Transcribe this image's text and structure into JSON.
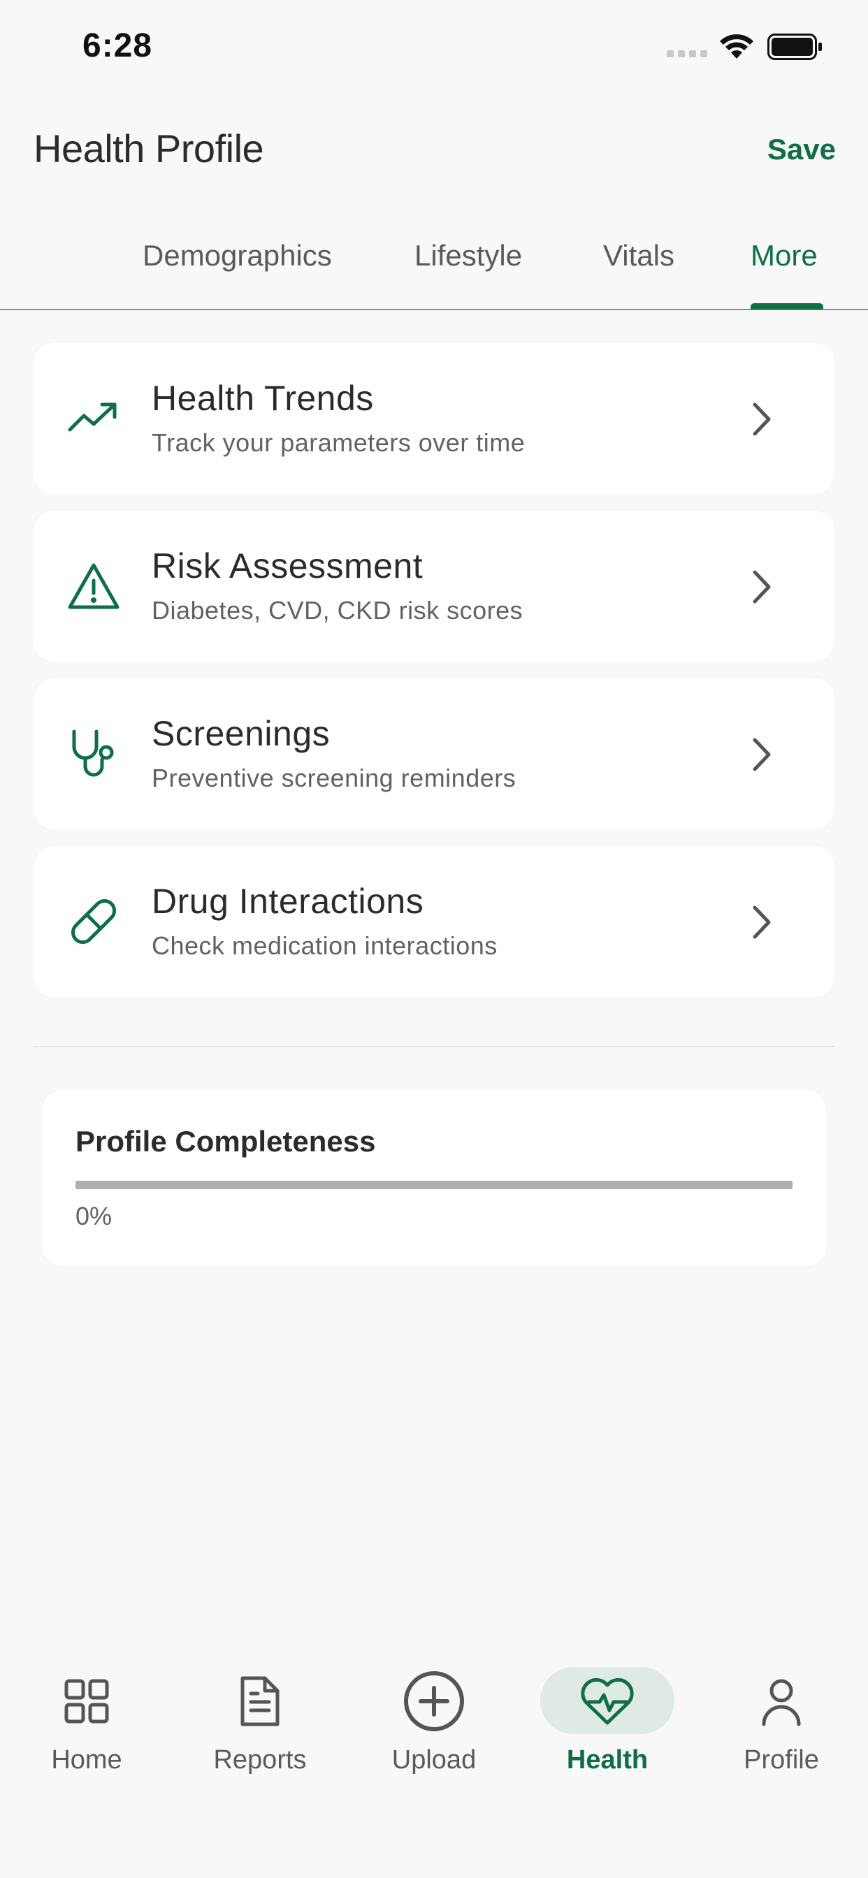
{
  "status_bar": {
    "time": "6:28"
  },
  "header": {
    "title": "Health Profile",
    "save_label": "Save"
  },
  "tabs": [
    {
      "label": "Demographics",
      "active": false
    },
    {
      "label": "Lifestyle",
      "active": false
    },
    {
      "label": "Vitals",
      "active": false
    },
    {
      "label": "More",
      "active": true
    }
  ],
  "menu_items": [
    {
      "icon": "trending-up-icon",
      "title": "Health Trends",
      "subtitle": "Track your parameters over time"
    },
    {
      "icon": "warning-icon",
      "title": "Risk Assessment",
      "subtitle": "Diabetes, CVD, CKD risk scores"
    },
    {
      "icon": "stethoscope-icon",
      "title": "Screenings",
      "subtitle": "Preventive screening reminders"
    },
    {
      "icon": "pill-icon",
      "title": "Drug Interactions",
      "subtitle": "Check medication interactions"
    }
  ],
  "profile_completeness": {
    "title": "Profile Completeness",
    "percent_label": "0%",
    "value": 0
  },
  "bottom_nav": [
    {
      "label": "Home",
      "icon": "grid-icon",
      "active": false
    },
    {
      "label": "Reports",
      "icon": "document-icon",
      "active": false
    },
    {
      "label": "Upload",
      "icon": "plus-circle-icon",
      "active": false
    },
    {
      "label": "Health",
      "icon": "heart-pulse-icon",
      "active": true
    },
    {
      "label": "Profile",
      "icon": "person-icon",
      "active": false
    }
  ],
  "colors": {
    "accent": "#0f6e45",
    "background": "#f8f8f8",
    "card": "#ffffff",
    "active_pill": "#dfeae4"
  }
}
